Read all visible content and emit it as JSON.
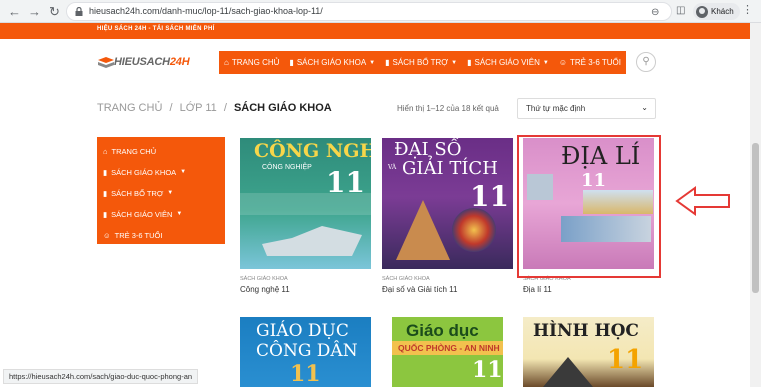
{
  "browser": {
    "url": "hieusach24h.com/danh-muc/lop-11/sach-giao-khoa-lop-11/",
    "profile_label": "Khách"
  },
  "site": {
    "top_strip_text": "HIỆU SÁCH 24H - TẢI SÁCH MIỄN PHÍ",
    "logo_text": "HIEUSACH",
    "logo_suffix": "24H",
    "nav": [
      {
        "label": "TRANG CHỦ",
        "icon": "home-icon"
      },
      {
        "label": "SÁCH GIÁO KHOA",
        "icon": "book-icon"
      },
      {
        "label": "SÁCH BỔ TRỢ",
        "icon": "book-icon"
      },
      {
        "label": "SÁCH GIÁO VIÊN",
        "icon": "book-icon"
      },
      {
        "label": "TRẺ 3-6 TUỔI",
        "icon": "child-icon"
      }
    ]
  },
  "breadcrumb": {
    "home": "TRANG CHỦ",
    "sep": "/",
    "level": "LỚP 11",
    "current": "SÁCH GIÁO KHOA"
  },
  "results": {
    "count_text": "Hiển thị 1–12 của 18 kết quả",
    "sort_label": "Thứ tự mặc định"
  },
  "sidebar": [
    {
      "label": "TRANG CHỦ"
    },
    {
      "label": "SÁCH GIÁO KHOA"
    },
    {
      "label": "SÁCH BỔ TRỢ"
    },
    {
      "label": "SÁCH GIÁO VIÊN"
    },
    {
      "label": "TRẺ 3-6 TUỔI"
    }
  ],
  "products": [
    {
      "category": "SÁCH GIÁO KHOA",
      "title": "Công nghệ 11",
      "cover_title": "CÔNG NGHỆ",
      "cover_sub": "CÔNG NGHIỆP",
      "grade": "11"
    },
    {
      "category": "SÁCH GIÁO KHOA",
      "title": "Đại số và Giải tích 11",
      "cover_title": "ĐẠI SỐ",
      "cover_sub": "GIẢI TÍCH",
      "cover_va": "VÀ",
      "grade": "11"
    },
    {
      "category": "SÁCH GIÁO KHOA",
      "title": "Địa lí 11",
      "cover_title": "ĐỊA LÍ",
      "grade": "11"
    },
    {
      "cover_title": "GIÁO DỤC",
      "cover_sub": "CÔNG DÂN",
      "grade": "11"
    },
    {
      "cover_title": "Giáo dục",
      "cover_sub": "QUỐC PHÒNG - AN NINH",
      "grade": "11"
    },
    {
      "cover_title": "HÌNH HỌC",
      "grade": "11"
    }
  ],
  "status_url": "https://hieusach24h.com/sach/giao-duc-quoc-phong-an",
  "colors": {
    "brand": "#f4580b",
    "highlight": "#e53935"
  }
}
